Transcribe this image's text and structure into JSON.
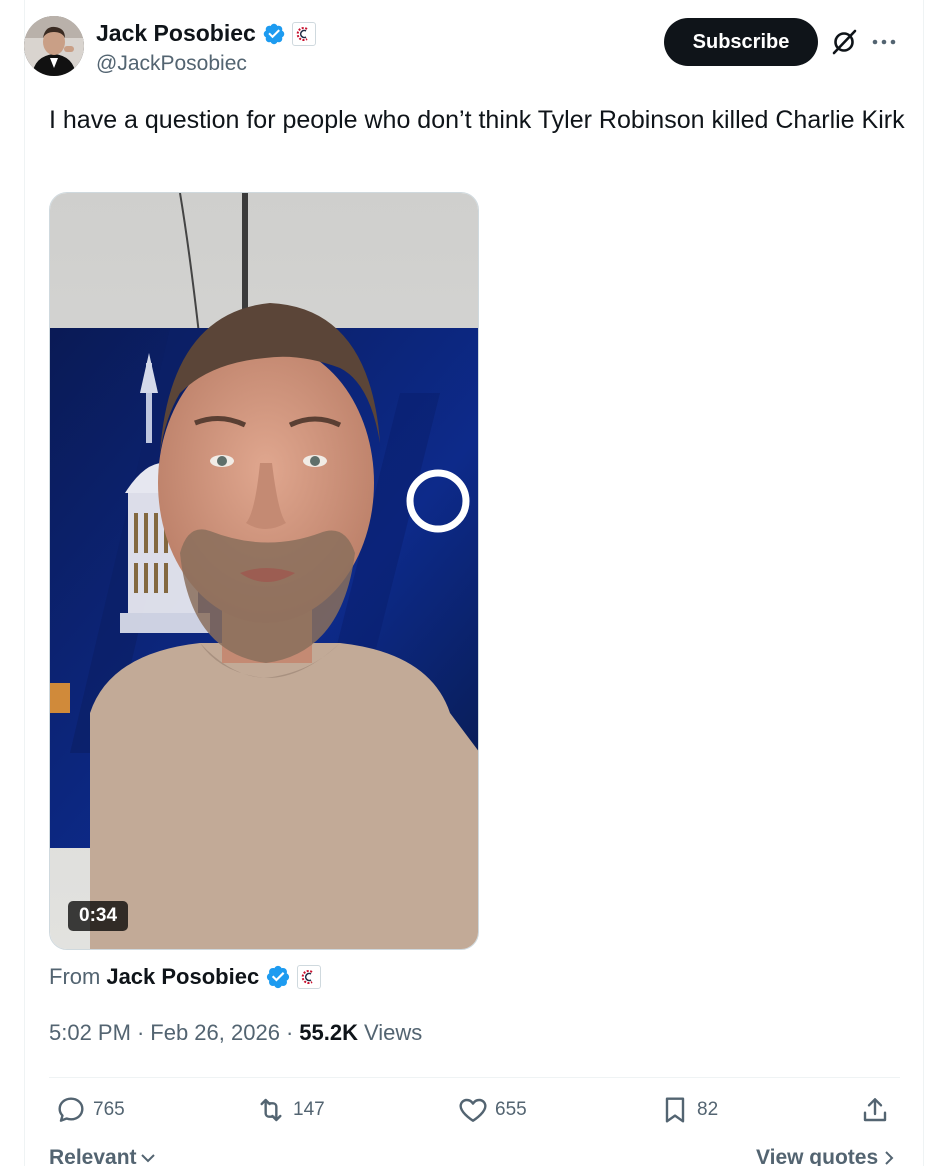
{
  "author": {
    "display_name": "Jack Posobiec",
    "handle": "@JackPosobiec",
    "verified_icon": "verified-badge-icon",
    "affiliation_icon": "affiliation-badge-icon"
  },
  "header_actions": {
    "subscribe_label": "Subscribe",
    "grok_icon": "grok-icon",
    "more_icon": "more-options-icon"
  },
  "tweet": {
    "text": "I have a question for people who don’t think Tyler Robinson killed Charlie Kirk"
  },
  "media": {
    "type": "video",
    "duration": "0:34"
  },
  "source": {
    "prefix": "From",
    "name": "Jack Posobiec"
  },
  "meta": {
    "time": "5:02 PM",
    "separator": "·",
    "date": "Feb 26, 2026",
    "views_count": "55.2K",
    "views_label": "Views"
  },
  "actions": {
    "replies": "765",
    "reposts": "147",
    "likes": "655",
    "bookmarks": "82"
  },
  "footer": {
    "sort_label": "Relevant",
    "quotes_label": "View quotes"
  },
  "colors": {
    "verified": "#1d9bf0",
    "text_primary": "#0f1419",
    "text_secondary": "#536471"
  }
}
